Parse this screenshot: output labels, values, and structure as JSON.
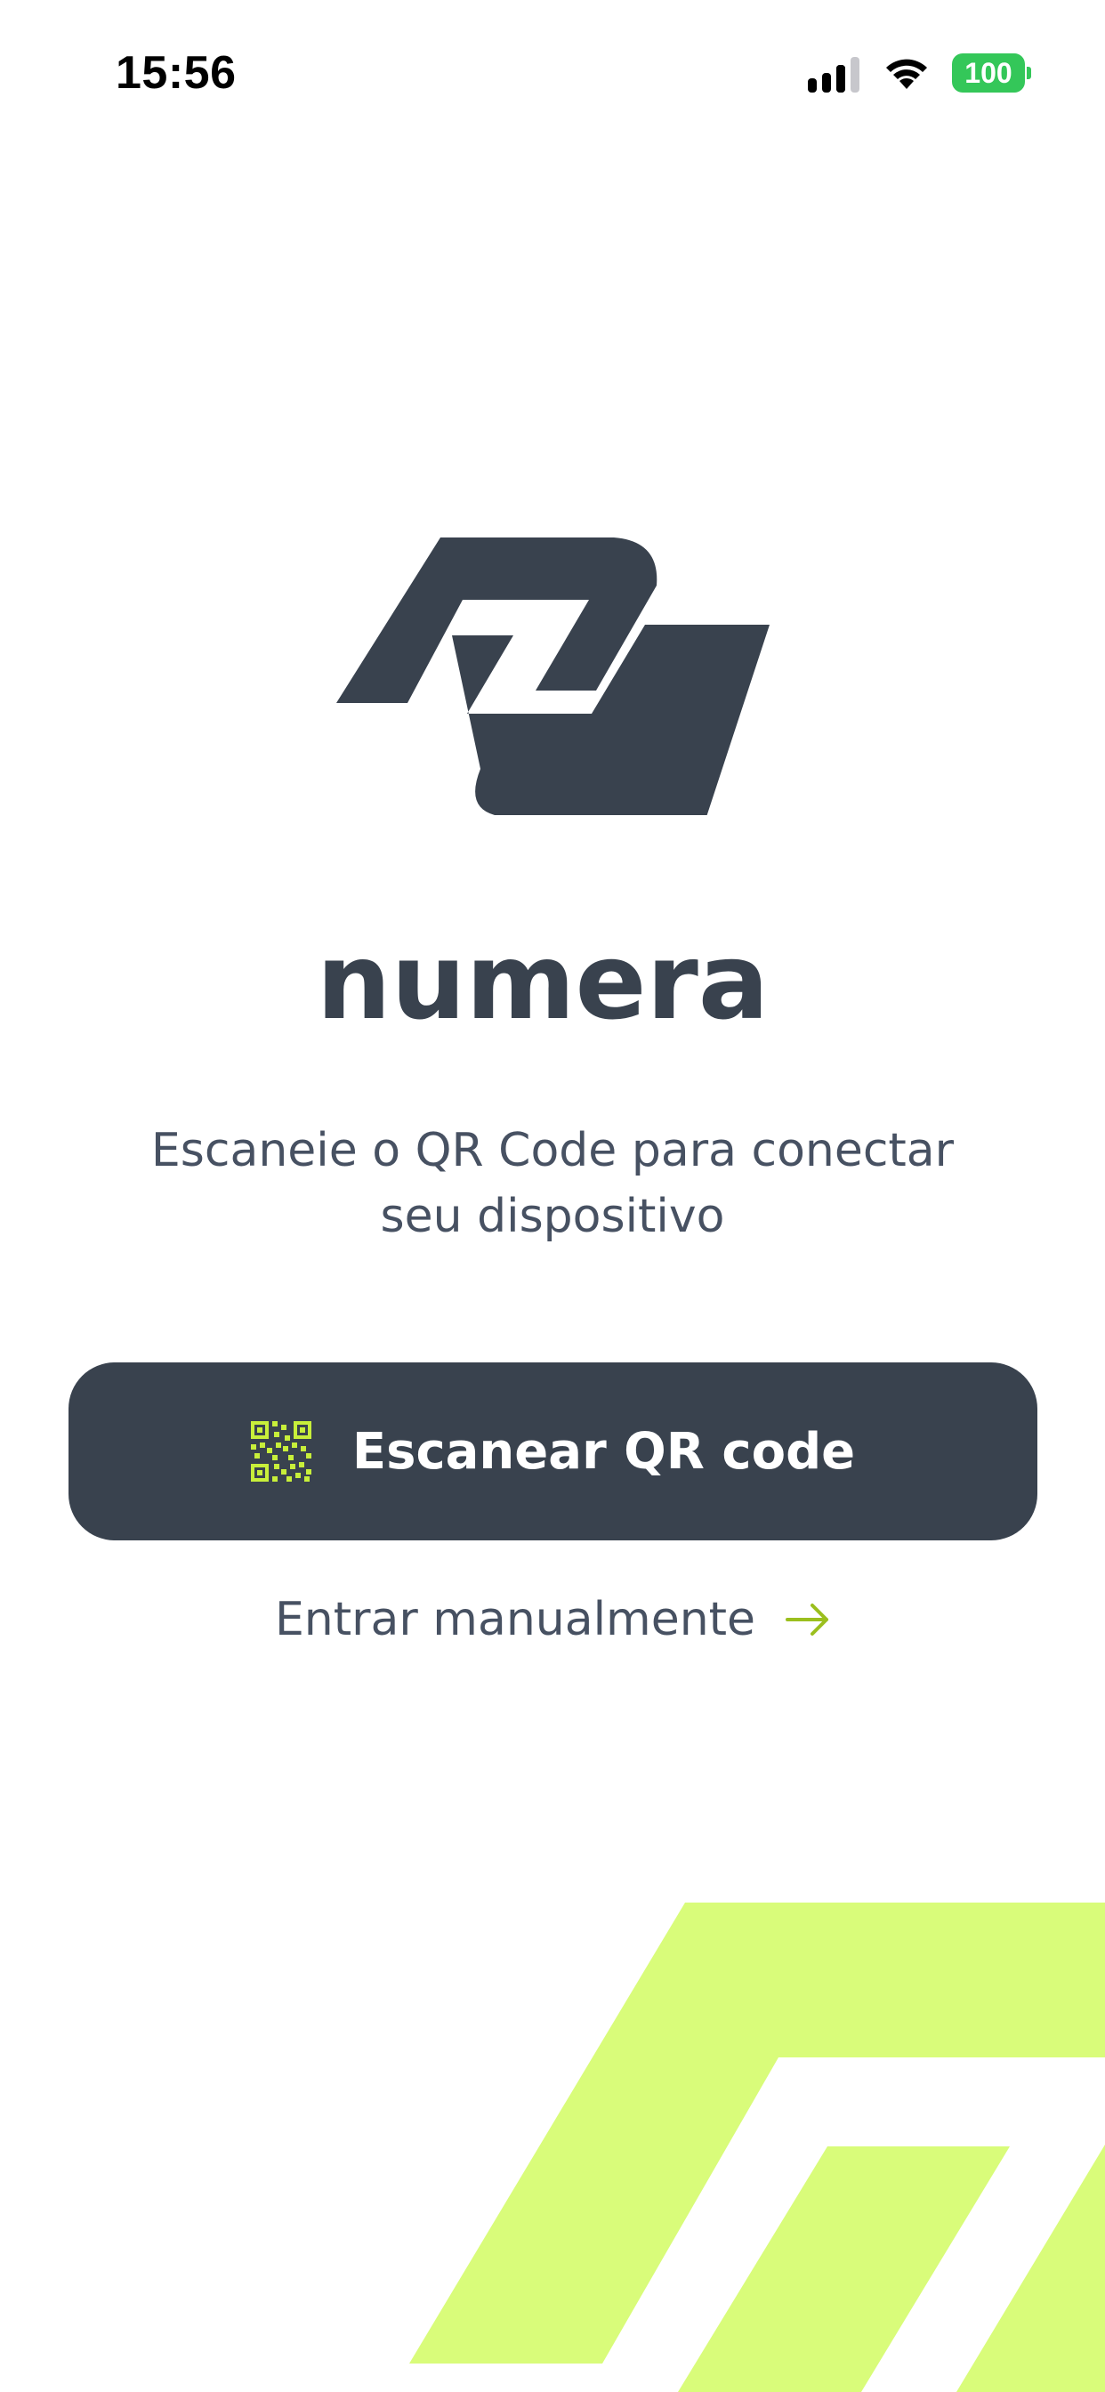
{
  "status_bar": {
    "time": "15:56",
    "battery_level": "100",
    "battery_color": "#34c759",
    "icons": [
      "signal-icon",
      "wifi-icon",
      "battery-icon"
    ]
  },
  "brand": {
    "name": "numera",
    "primary_color": "#39424e",
    "accent_color": "#d9fc7a",
    "logo": "numera-logo-icon"
  },
  "main": {
    "instruction": "Escaneie o QR Code para conectar seu dispositivo",
    "scan_button_label": "Escanear QR code",
    "scan_button_icon": "qr-code-icon",
    "manual_link_label": "Entrar manualmente",
    "manual_link_icon": "arrow-right-icon"
  }
}
